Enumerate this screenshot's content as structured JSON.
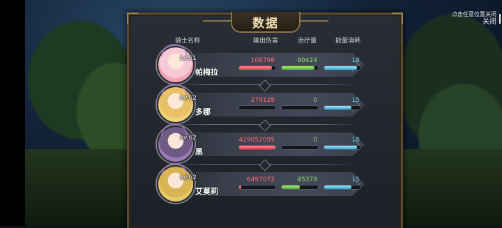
{
  "close": {
    "hint": "点击任意位置关闭",
    "label": "关闭"
  },
  "panel": {
    "title": "数据",
    "headers": {
      "name": "骑士名称",
      "damage": "输出伤害",
      "heal": "治疗量",
      "energy": "能量消耗"
    }
  },
  "knights": [
    {
      "name": "帕梅拉",
      "level": "Lv.61",
      "damage": "108798",
      "heal": "90424",
      "energy": "18",
      "damage_fill": 0.9,
      "heal_fill": 0.9,
      "energy_fill": 0.9,
      "portrait_color": "#f3a3b7",
      "hair_color": "#f7c9d6"
    },
    {
      "name": "多娜",
      "level": "Lv.62",
      "damage": "279128",
      "heal": "0",
      "energy": "15",
      "damage_fill": 0.0,
      "heal_fill": 0.0,
      "energy_fill": 0.75,
      "portrait_color": "#f1d27c",
      "hair_color": "#e8c066"
    },
    {
      "name": "黑",
      "level": "Lv.62",
      "damage": "429052095",
      "heal": "0",
      "energy": "18",
      "damage_fill": 1.0,
      "heal_fill": 0.0,
      "energy_fill": 0.9,
      "portrait_color": "#9c7ab8",
      "hair_color": "#6d5a85"
    },
    {
      "name": "艾莫莉",
      "level": "Lv.62",
      "damage": "6497072",
      "heal": "45379",
      "energy": "15",
      "damage_fill": 0.05,
      "heal_fill": 0.5,
      "energy_fill": 0.75,
      "portrait_color": "#e8c96a",
      "hair_color": "#d8b452"
    }
  ]
}
